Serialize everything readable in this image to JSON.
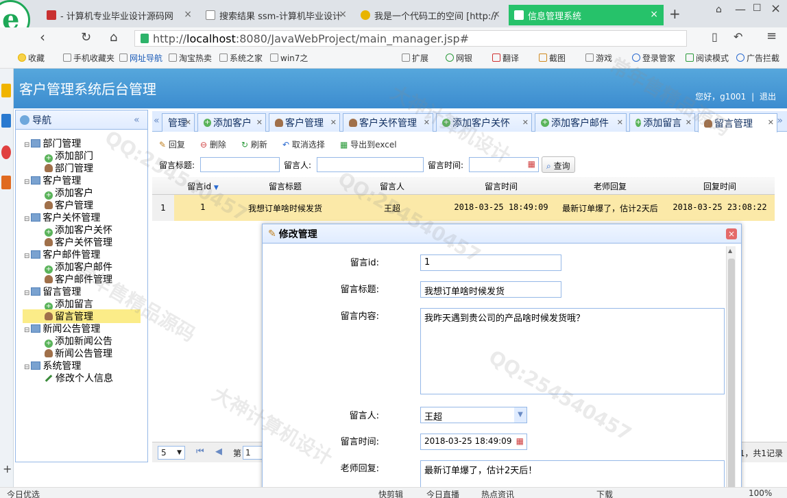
{
  "browser": {
    "tabs": [
      {
        "label": "- 计算机专业毕业设计源码网",
        "color": "#c83030",
        "active": false
      },
      {
        "label": "搜索结果 ssm-计算机毕业设计",
        "color": "#888888",
        "active": false
      },
      {
        "label": "我是一个代码工的空间 [http://",
        "color": "#e8b400",
        "active": false
      },
      {
        "label": "信息管理系统",
        "color": "#26c26a",
        "active": true
      }
    ],
    "new_tab": "+",
    "url_host": "localhost",
    "url_prefix": "http://",
    "url_rest": ":8080/JavaWebProject/main_manager.jsp#",
    "bookmarks": [
      "收藏",
      "手机收藏夹",
      "网址导航",
      "淘宝热卖",
      "系统之家",
      "win7之",
      "扩展",
      "网银",
      "翻译",
      "截图",
      "游戏",
      "登录管家",
      "阅读模式",
      "广告拦截"
    ]
  },
  "app": {
    "title": "客户管理系统后台管理",
    "greeting": "您好，g1001",
    "logout": "退出"
  },
  "nav": {
    "title": "导航",
    "collapse": "«",
    "groups": [
      {
        "label": "部门管理",
        "items": [
          {
            "label": "添加部门",
            "icon": "add"
          },
          {
            "label": "部门管理",
            "icon": "user"
          }
        ]
      },
      {
        "label": "客户管理",
        "items": [
          {
            "label": "添加客户",
            "icon": "add"
          },
          {
            "label": "客户管理",
            "icon": "user"
          }
        ]
      },
      {
        "label": "客户关怀管理",
        "items": [
          {
            "label": "添加客户关怀",
            "icon": "add"
          },
          {
            "label": "客户关怀管理",
            "icon": "user"
          }
        ]
      },
      {
        "label": "客户邮件管理",
        "items": [
          {
            "label": "添加客户邮件",
            "icon": "add"
          },
          {
            "label": "客户邮件管理",
            "icon": "user"
          }
        ]
      },
      {
        "label": "留言管理",
        "items": [
          {
            "label": "添加留言",
            "icon": "add"
          },
          {
            "label": "留言管理",
            "icon": "user",
            "selected": true
          }
        ]
      },
      {
        "label": "新闻公告管理",
        "items": [
          {
            "label": "添加新闻公告",
            "icon": "add"
          },
          {
            "label": "新闻公告管理",
            "icon": "user"
          }
        ]
      },
      {
        "label": "系统管理",
        "items": [
          {
            "label": "修改个人信息",
            "icon": "edit"
          }
        ]
      }
    ]
  },
  "content_tabs": [
    {
      "label": "管理",
      "icon": "none",
      "active": false
    },
    {
      "label": "添加客户",
      "icon": "add",
      "active": false
    },
    {
      "label": "客户管理",
      "icon": "user",
      "active": false
    },
    {
      "label": "客户关怀管理",
      "icon": "user",
      "active": false
    },
    {
      "label": "添加客户关怀",
      "icon": "add",
      "active": false
    },
    {
      "label": "添加客户邮件",
      "icon": "add",
      "active": false
    },
    {
      "label": "添加留言",
      "icon": "add",
      "active": false
    },
    {
      "label": "留言管理",
      "icon": "user",
      "active": true
    }
  ],
  "toolbar": {
    "edit": "回复",
    "delete": "删除",
    "refresh": "刷新",
    "unselect": "取消选择",
    "export": "导出到excel"
  },
  "search": {
    "title_label": "留言标题:",
    "person_label": "留言人:",
    "time_label": "留言时间:",
    "button": "查询"
  },
  "grid": {
    "columns": [
      "留言id",
      "留言标题",
      "留言人",
      "留言时间",
      "老师回复",
      "回复时间"
    ],
    "rows": [
      {
        "num": "1",
        "id": "1",
        "title": "我想订单啥时候发货",
        "person": "王超",
        "time": "2018-03-25 18:49:09",
        "reply": "最新订单爆了，估计2天后",
        "reply_time": "2018-03-25 23:08:22"
      }
    ],
    "page_size": "5",
    "page_label": "第",
    "page_value": "1",
    "summary": "则1，共1记录"
  },
  "modal": {
    "title": "修改管理",
    "close": "×",
    "fields": {
      "id_label": "留言id:",
      "id_value": "1",
      "title_label": "留言标题:",
      "title_value": "我想订单啥时候发货",
      "content_label": "留言内容:",
      "content_value": "我昨天遇到贵公司的产品啥时候发货哦？",
      "person_label": "留言人:",
      "person_value": "王超",
      "time_label": "留言时间:",
      "time_value": "2018-03-25 18:49:09",
      "reply_label": "老师回复:",
      "reply_value": "最新订单爆了，估计2天后！"
    }
  },
  "statusbar": {
    "left": "今日优选",
    "items": [
      "快剪辑",
      "今日直播",
      "热点资讯",
      "下载"
    ],
    "zoom": "100%"
  },
  "watermarks": [
    "QQ:254540457",
    "常年售精品源码",
    "大神计算机设计"
  ]
}
